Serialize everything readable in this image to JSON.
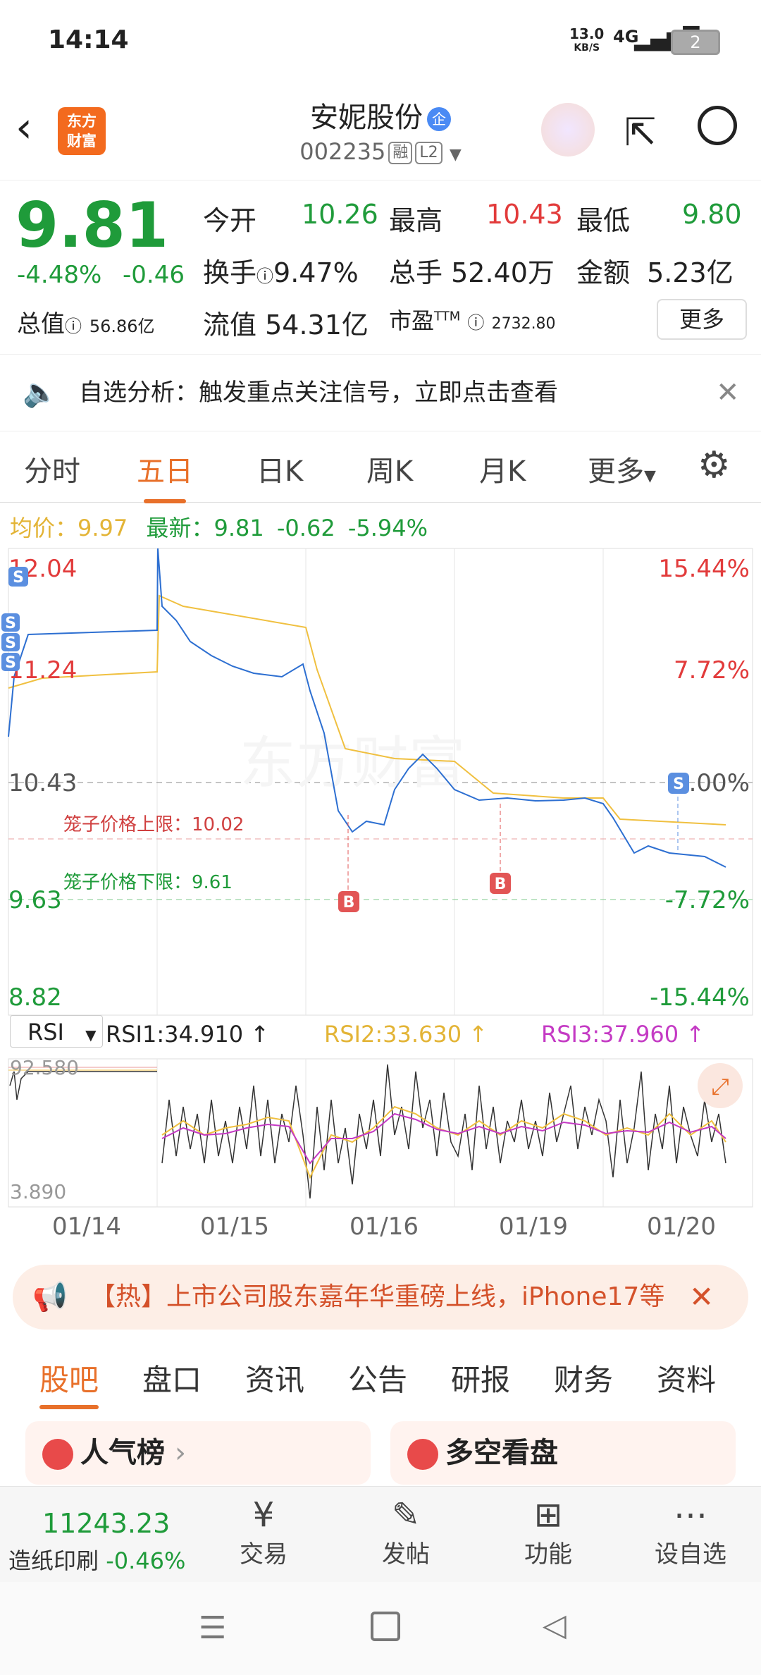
{
  "status": {
    "time": "14:14",
    "net_speed": "13.0",
    "net_unit": "KB/S",
    "signal": "4G",
    "battery": "2"
  },
  "header": {
    "logo_line1": "东方",
    "logo_line2": "财富",
    "name": "安妮股份",
    "badge": "企",
    "code": "002235",
    "tag1": "融",
    "tag2": "L2"
  },
  "quote": {
    "price": "9.81",
    "pct": "-4.48%",
    "chg": "-0.46",
    "open_label": "今开",
    "open": "10.26",
    "high_label": "最高",
    "high": "10.43",
    "low_label": "最低",
    "low": "9.80",
    "turnover_label": "换手",
    "turnover": "9.47%",
    "vol_label": "总手",
    "vol": "52.40万",
    "amount_label": "金额",
    "amount": "5.23亿",
    "mcap_label": "总值",
    "mcap": "56.86亿",
    "float_label": "流值",
    "float": "54.31亿",
    "pe_label": "市盈",
    "pe_sup": "TTM",
    "pe": "2732.80",
    "more": "更多"
  },
  "notice": {
    "text": "自选分析：触发重点关注信号，立即点击查看"
  },
  "tabs": [
    "分时",
    "五日",
    "日K",
    "周K",
    "月K",
    "更多"
  ],
  "chart_info": {
    "avg_label": "均价：",
    "avg": "9.97",
    "latest_label": "最新：",
    "latest": "9.81",
    "chg": "-0.62",
    "pct": "-5.94%"
  },
  "chart_data": {
    "type": "line",
    "y_left_ticks": [
      "12.04",
      "11.24",
      "10.43",
      "9.63",
      "8.82"
    ],
    "y_right_ticks": [
      "15.44%",
      "7.72%",
      "0.00%",
      "-7.72%",
      "-15.44%"
    ],
    "upper_label": "笼子价格上限：10.02",
    "lower_label": "笼子价格下限：9.61",
    "x_labels": [
      "01/14",
      "01/15",
      "01/16",
      "01/19",
      "01/20"
    ],
    "ylim": [
      8.82,
      12.04
    ],
    "markers": [
      "S",
      "S",
      "S",
      "S",
      "B",
      "B",
      "S"
    ],
    "watermark": "东方财富"
  },
  "rsi": {
    "select": "RSI",
    "rsi1": "RSI1:34.910 ↑",
    "rsi2": "RSI2:33.630 ↑",
    "rsi3": "RSI3:37.960 ↑",
    "top": "92.580",
    "bottom": "3.890"
  },
  "banner": {
    "text": "【热】上市公司股东嘉年华重磅上线，iPhone17等"
  },
  "btabs": [
    "股吧",
    "盘口",
    "资讯",
    "公告",
    "研报",
    "财务",
    "资料"
  ],
  "cards": {
    "left": "人气榜",
    "right": "多空看盘"
  },
  "nav": {
    "index": "11243.23",
    "index_name": "造纸印刷",
    "index_pct": "-0.46%",
    "trade": "交易",
    "post": "发帖",
    "func": "功能",
    "watch": "设自选"
  },
  "colors": {
    "accent": "#e8702a",
    "up": "#e23b3b",
    "down": "#1f9b3a"
  }
}
